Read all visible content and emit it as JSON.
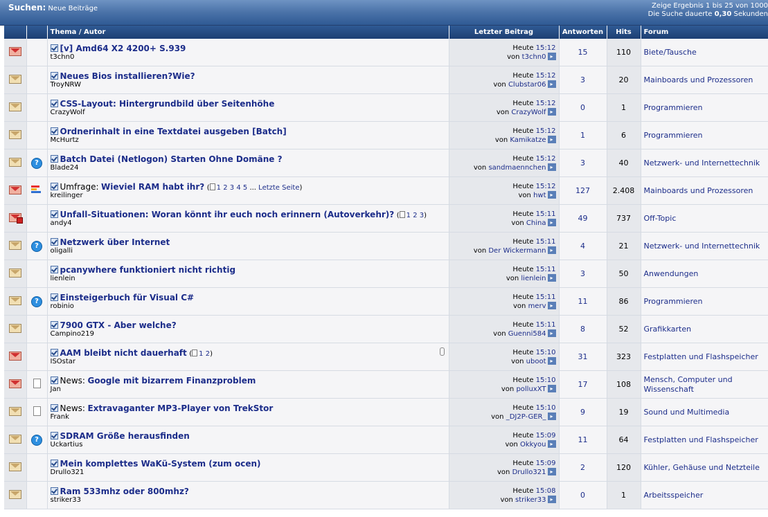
{
  "header": {
    "title": "Suchen:",
    "subtitle": "Neue Beiträge",
    "result_info": "Zeige Ergebnis 1 bis 25 von 1000",
    "search_time_prefix": "Die Suche dauerte",
    "search_time_value": "0,30",
    "search_time_suffix": "Sekunden"
  },
  "columns": {
    "topic": "Thema / Autor",
    "last_post": "Letzter Beitrag",
    "replies": "Antworten",
    "hits": "Hits",
    "forum": "Forum"
  },
  "threads": [
    {
      "envelope": "hot",
      "icon2": "",
      "prefix": "",
      "title": "[v] Amd64 X2 4200+ S.939",
      "author": "t3chn0",
      "pages": [],
      "last_date": "Heute",
      "last_time": "15:12",
      "last_by": "von",
      "last_user": "t3chn0",
      "replies": "15",
      "hits": "110",
      "forum": "Biete/Tausche",
      "attach": false
    },
    {
      "envelope": "normal",
      "icon2": "",
      "prefix": "",
      "title": "Neues Bios installieren?Wie?",
      "author": "TroyNRW",
      "pages": [],
      "last_date": "Heute",
      "last_time": "15:12",
      "last_by": "von",
      "last_user": "Clubstar06",
      "replies": "3",
      "hits": "20",
      "forum": "Mainboards und Prozessoren",
      "attach": false
    },
    {
      "envelope": "normal",
      "icon2": "",
      "prefix": "",
      "title": "CSS-Layout: Hintergrundbild über Seitenhöhe",
      "author": "CrazyWolf",
      "pages": [],
      "last_date": "Heute",
      "last_time": "15:12",
      "last_by": "von",
      "last_user": "CrazyWolf",
      "replies": "0",
      "hits": "1",
      "forum": "Programmieren",
      "attach": false
    },
    {
      "envelope": "normal",
      "icon2": "",
      "prefix": "",
      "title": "Ordnerinhalt in eine Textdatei ausgeben [Batch]",
      "author": "McHurtz",
      "pages": [],
      "last_date": "Heute",
      "last_time": "15:12",
      "last_by": "von",
      "last_user": "Kamikatze",
      "replies": "1",
      "hits": "6",
      "forum": "Programmieren",
      "attach": false
    },
    {
      "envelope": "normal",
      "icon2": "question",
      "prefix": "",
      "title": "Batch Datei (Netlogon) Starten Ohne Domäne ?",
      "author": "Blade24",
      "pages": [],
      "last_date": "Heute",
      "last_time": "15:12",
      "last_by": "von",
      "last_user": "sandmaennchen",
      "replies": "3",
      "hits": "40",
      "forum": "Netzwerk- und Internettechnik",
      "attach": false
    },
    {
      "envelope": "hot",
      "icon2": "poll",
      "prefix": "Umfrage:",
      "title": "Wieviel RAM habt ihr?",
      "author": "kreilinger",
      "pages": [
        "1",
        "2",
        "3",
        "4",
        "5",
        "...",
        "Letzte Seite"
      ],
      "last_date": "Heute",
      "last_time": "15:12",
      "last_by": "von",
      "last_user": "hwt",
      "replies": "127",
      "hits": "2.408",
      "forum": "Mainboards und Prozessoren",
      "attach": false
    },
    {
      "envelope": "hotlock",
      "icon2": "",
      "prefix": "",
      "title": "Unfall-Situationen: Woran könnt ihr euch noch erinnern (Autoverkehr)?",
      "author": "andy4",
      "pages": [
        "1",
        "2",
        "3"
      ],
      "last_date": "Heute",
      "last_time": "15:11",
      "last_by": "von",
      "last_user": "China",
      "replies": "49",
      "hits": "737",
      "forum": "Off-Topic",
      "attach": false
    },
    {
      "envelope": "normal",
      "icon2": "question",
      "prefix": "",
      "title": "Netzwerk über Internet",
      "author": "oligalli",
      "pages": [],
      "last_date": "Heute",
      "last_time": "15:11",
      "last_by": "von",
      "last_user": "Der Wickermann",
      "replies": "4",
      "hits": "21",
      "forum": "Netzwerk- und Internettechnik",
      "attach": false
    },
    {
      "envelope": "normal",
      "icon2": "",
      "prefix": "",
      "title": "pcanywhere funktioniert nicht richtig",
      "author": "lienlein",
      "pages": [],
      "last_date": "Heute",
      "last_time": "15:11",
      "last_by": "von",
      "last_user": "lienlein",
      "replies": "3",
      "hits": "50",
      "forum": "Anwendungen",
      "attach": false
    },
    {
      "envelope": "normal",
      "icon2": "question",
      "prefix": "",
      "title": "Einsteigerbuch für Visual C#",
      "author": "robinio",
      "pages": [],
      "last_date": "Heute",
      "last_time": "15:11",
      "last_by": "von",
      "last_user": "merv",
      "replies": "11",
      "hits": "86",
      "forum": "Programmieren",
      "attach": false
    },
    {
      "envelope": "normal",
      "icon2": "",
      "prefix": "",
      "title": "7900 GTX - Aber welche?",
      "author": "Campino219",
      "pages": [],
      "last_date": "Heute",
      "last_time": "15:11",
      "last_by": "von",
      "last_user": "Guenni584",
      "replies": "8",
      "hits": "52",
      "forum": "Grafikkarten",
      "attach": false
    },
    {
      "envelope": "hot",
      "icon2": "",
      "prefix": "",
      "title": "AAM bleibt nicht dauerhaft",
      "author": "ISOstar",
      "pages": [
        "1",
        "2"
      ],
      "last_date": "Heute",
      "last_time": "15:10",
      "last_by": "von",
      "last_user": "uboot",
      "replies": "31",
      "hits": "323",
      "forum": "Festplatten und Flashspeicher",
      "attach": true
    },
    {
      "envelope": "hot",
      "icon2": "doc",
      "prefix": "News:",
      "title": "Google mit bizarrem Finanzproblem",
      "author": "Jan",
      "pages": [],
      "last_date": "Heute",
      "last_time": "15:10",
      "last_by": "von",
      "last_user": "polluxXT",
      "replies": "17",
      "hits": "108",
      "forum": "Mensch, Computer und Wissenschaft",
      "attach": false
    },
    {
      "envelope": "normal",
      "icon2": "doc",
      "prefix": "News:",
      "title": "Extravaganter MP3-Player von TrekStor",
      "author": "Frank",
      "pages": [],
      "last_date": "Heute",
      "last_time": "15:10",
      "last_by": "von",
      "last_user": "_DJ2P-GER_",
      "replies": "9",
      "hits": "19",
      "forum": "Sound und Multimedia",
      "attach": false
    },
    {
      "envelope": "normal",
      "icon2": "question",
      "prefix": "",
      "title": "SDRAM Größe herausfinden",
      "author": "Uckartius",
      "pages": [],
      "last_date": "Heute",
      "last_time": "15:09",
      "last_by": "von",
      "last_user": "Okkyou",
      "replies": "11",
      "hits": "64",
      "forum": "Festplatten und Flashspeicher",
      "attach": false
    },
    {
      "envelope": "normal",
      "icon2": "",
      "prefix": "",
      "title": "Mein komplettes WaKü-System (zum ocen)",
      "author": "Drullo321",
      "pages": [],
      "last_date": "Heute",
      "last_time": "15:09",
      "last_by": "von",
      "last_user": "Drullo321",
      "replies": "2",
      "hits": "120",
      "forum": "Kühler, Gehäuse und Netzteile",
      "attach": false
    },
    {
      "envelope": "normal",
      "icon2": "",
      "prefix": "",
      "title": "Ram 533mhz oder 800mhz?",
      "author": "striker33",
      "pages": [],
      "last_date": "Heute",
      "last_time": "15:08",
      "last_by": "von",
      "last_user": "striker33",
      "replies": "0",
      "hits": "1",
      "forum": "Arbeitsspeicher",
      "attach": false
    }
  ]
}
